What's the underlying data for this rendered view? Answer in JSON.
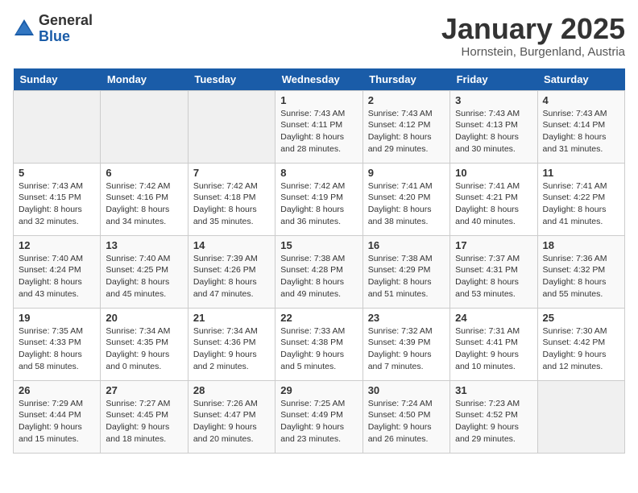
{
  "logo": {
    "general": "General",
    "blue": "Blue"
  },
  "header": {
    "month": "January 2025",
    "location": "Hornstein, Burgenland, Austria"
  },
  "days_of_week": [
    "Sunday",
    "Monday",
    "Tuesday",
    "Wednesday",
    "Thursday",
    "Friday",
    "Saturday"
  ],
  "weeks": [
    [
      {
        "day": "",
        "info": ""
      },
      {
        "day": "",
        "info": ""
      },
      {
        "day": "",
        "info": ""
      },
      {
        "day": "1",
        "info": "Sunrise: 7:43 AM\nSunset: 4:11 PM\nDaylight: 8 hours\nand 28 minutes."
      },
      {
        "day": "2",
        "info": "Sunrise: 7:43 AM\nSunset: 4:12 PM\nDaylight: 8 hours\nand 29 minutes."
      },
      {
        "day": "3",
        "info": "Sunrise: 7:43 AM\nSunset: 4:13 PM\nDaylight: 8 hours\nand 30 minutes."
      },
      {
        "day": "4",
        "info": "Sunrise: 7:43 AM\nSunset: 4:14 PM\nDaylight: 8 hours\nand 31 minutes."
      }
    ],
    [
      {
        "day": "5",
        "info": "Sunrise: 7:43 AM\nSunset: 4:15 PM\nDaylight: 8 hours\nand 32 minutes."
      },
      {
        "day": "6",
        "info": "Sunrise: 7:42 AM\nSunset: 4:16 PM\nDaylight: 8 hours\nand 34 minutes."
      },
      {
        "day": "7",
        "info": "Sunrise: 7:42 AM\nSunset: 4:18 PM\nDaylight: 8 hours\nand 35 minutes."
      },
      {
        "day": "8",
        "info": "Sunrise: 7:42 AM\nSunset: 4:19 PM\nDaylight: 8 hours\nand 36 minutes."
      },
      {
        "day": "9",
        "info": "Sunrise: 7:41 AM\nSunset: 4:20 PM\nDaylight: 8 hours\nand 38 minutes."
      },
      {
        "day": "10",
        "info": "Sunrise: 7:41 AM\nSunset: 4:21 PM\nDaylight: 8 hours\nand 40 minutes."
      },
      {
        "day": "11",
        "info": "Sunrise: 7:41 AM\nSunset: 4:22 PM\nDaylight: 8 hours\nand 41 minutes."
      }
    ],
    [
      {
        "day": "12",
        "info": "Sunrise: 7:40 AM\nSunset: 4:24 PM\nDaylight: 8 hours\nand 43 minutes."
      },
      {
        "day": "13",
        "info": "Sunrise: 7:40 AM\nSunset: 4:25 PM\nDaylight: 8 hours\nand 45 minutes."
      },
      {
        "day": "14",
        "info": "Sunrise: 7:39 AM\nSunset: 4:26 PM\nDaylight: 8 hours\nand 47 minutes."
      },
      {
        "day": "15",
        "info": "Sunrise: 7:38 AM\nSunset: 4:28 PM\nDaylight: 8 hours\nand 49 minutes."
      },
      {
        "day": "16",
        "info": "Sunrise: 7:38 AM\nSunset: 4:29 PM\nDaylight: 8 hours\nand 51 minutes."
      },
      {
        "day": "17",
        "info": "Sunrise: 7:37 AM\nSunset: 4:31 PM\nDaylight: 8 hours\nand 53 minutes."
      },
      {
        "day": "18",
        "info": "Sunrise: 7:36 AM\nSunset: 4:32 PM\nDaylight: 8 hours\nand 55 minutes."
      }
    ],
    [
      {
        "day": "19",
        "info": "Sunrise: 7:35 AM\nSunset: 4:33 PM\nDaylight: 8 hours\nand 58 minutes."
      },
      {
        "day": "20",
        "info": "Sunrise: 7:34 AM\nSunset: 4:35 PM\nDaylight: 9 hours\nand 0 minutes."
      },
      {
        "day": "21",
        "info": "Sunrise: 7:34 AM\nSunset: 4:36 PM\nDaylight: 9 hours\nand 2 minutes."
      },
      {
        "day": "22",
        "info": "Sunrise: 7:33 AM\nSunset: 4:38 PM\nDaylight: 9 hours\nand 5 minutes."
      },
      {
        "day": "23",
        "info": "Sunrise: 7:32 AM\nSunset: 4:39 PM\nDaylight: 9 hours\nand 7 minutes."
      },
      {
        "day": "24",
        "info": "Sunrise: 7:31 AM\nSunset: 4:41 PM\nDaylight: 9 hours\nand 10 minutes."
      },
      {
        "day": "25",
        "info": "Sunrise: 7:30 AM\nSunset: 4:42 PM\nDaylight: 9 hours\nand 12 minutes."
      }
    ],
    [
      {
        "day": "26",
        "info": "Sunrise: 7:29 AM\nSunset: 4:44 PM\nDaylight: 9 hours\nand 15 minutes."
      },
      {
        "day": "27",
        "info": "Sunrise: 7:27 AM\nSunset: 4:45 PM\nDaylight: 9 hours\nand 18 minutes."
      },
      {
        "day": "28",
        "info": "Sunrise: 7:26 AM\nSunset: 4:47 PM\nDaylight: 9 hours\nand 20 minutes."
      },
      {
        "day": "29",
        "info": "Sunrise: 7:25 AM\nSunset: 4:49 PM\nDaylight: 9 hours\nand 23 minutes."
      },
      {
        "day": "30",
        "info": "Sunrise: 7:24 AM\nSunset: 4:50 PM\nDaylight: 9 hours\nand 26 minutes."
      },
      {
        "day": "31",
        "info": "Sunrise: 7:23 AM\nSunset: 4:52 PM\nDaylight: 9 hours\nand 29 minutes."
      },
      {
        "day": "",
        "info": ""
      }
    ]
  ]
}
